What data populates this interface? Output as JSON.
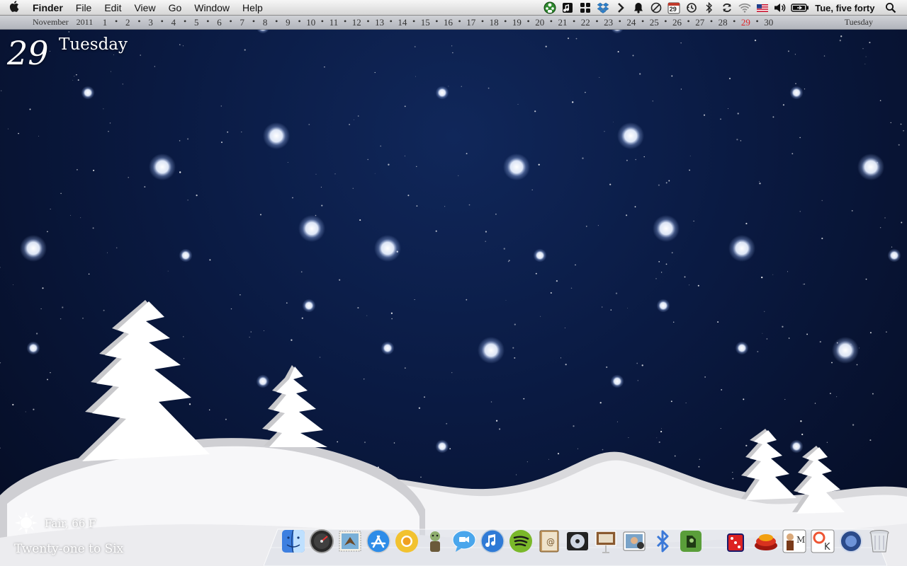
{
  "menubar": {
    "apple_icon": "apple-icon",
    "app_name": "Finder",
    "menus": [
      "File",
      "Edit",
      "View",
      "Go",
      "Window",
      "Help"
    ],
    "status_icons": [
      "ladybug-icon",
      "note-icon",
      "grid-icon",
      "dropbox-icon",
      "chevron-right-icon",
      "bell-icon",
      "no-entry-icon",
      "calendar-icon",
      "time-machine-icon",
      "bluetooth-icon",
      "sync-icon",
      "wifi-icon",
      "us-flag-icon",
      "volume-icon",
      "battery-icon"
    ],
    "calendar_icon_day": "29",
    "clock": "Tue, five forty",
    "spotlight_icon": "search-icon"
  },
  "calendar_strip": {
    "month": "November",
    "year": "2011",
    "days": [
      "1",
      "2",
      "3",
      "4",
      "5",
      "6",
      "7",
      "8",
      "9",
      "10",
      "11",
      "12",
      "13",
      "14",
      "15",
      "16",
      "17",
      "18",
      "19",
      "20",
      "21",
      "22",
      "23",
      "24",
      "25",
      "26",
      "27",
      "28",
      "29",
      "30"
    ],
    "today": "29",
    "today_color": "#e0252a",
    "weekday": "Tuesday"
  },
  "date_widget": {
    "day": "29",
    "weekday": "Tuesday"
  },
  "weather": {
    "icon": "sun-icon",
    "summary": "Fair, 66 F",
    "daylight": "Twenty-one to Six"
  },
  "dock": {
    "items": [
      {
        "name": "finder",
        "icon": "finder-icon"
      },
      {
        "name": "dashboard",
        "icon": "dashboard-icon"
      },
      {
        "name": "mail-stamp",
        "icon": "eagle-stamp-icon"
      },
      {
        "name": "app-store",
        "icon": "app-store-icon"
      },
      {
        "name": "chrome",
        "icon": "chrome-icon"
      },
      {
        "name": "zombie",
        "icon": "zombie-icon"
      },
      {
        "name": "messages",
        "icon": "chat-bubble-icon"
      },
      {
        "name": "itunes",
        "icon": "music-note-icon"
      },
      {
        "name": "spotify",
        "icon": "spotify-icon"
      },
      {
        "name": "address-book",
        "icon": "address-book-icon"
      },
      {
        "name": "dvd-player",
        "icon": "dvd-icon"
      },
      {
        "name": "keynote",
        "icon": "keynote-icon"
      },
      {
        "name": "photo-booth",
        "icon": "photo-icon"
      },
      {
        "name": "bluetooth",
        "icon": "bluetooth-icon"
      },
      {
        "name": "evernote",
        "icon": "evernote-icon"
      },
      {
        "name": "dice-game",
        "icon": "dice-icon"
      },
      {
        "name": "red-stack",
        "icon": "red-stack-icon"
      },
      {
        "name": "man-m",
        "icon": "man-m-icon"
      },
      {
        "name": "bowling-k",
        "icon": "pins-k-icon"
      },
      {
        "name": "downloads",
        "icon": "stack-circle-icon"
      },
      {
        "name": "trash",
        "icon": "trash-icon"
      }
    ]
  }
}
